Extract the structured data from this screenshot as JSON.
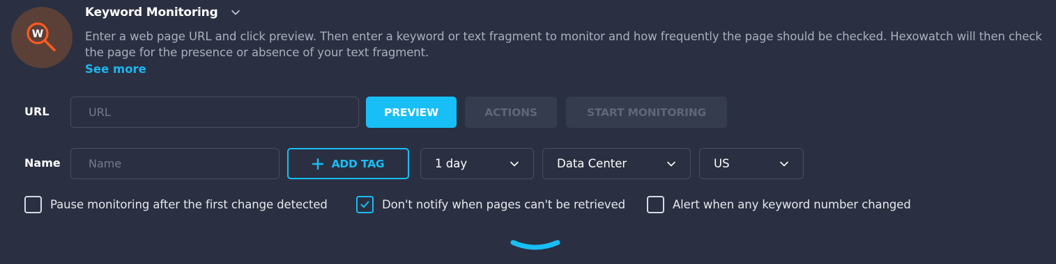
{
  "header": {
    "title": "Keyword Monitoring",
    "description": "Enter a web page URL and click preview. Then enter a keyword or text fragment to monitor and how frequently the page should be checked. Hexowatch will then check the page for the presence or absence of your text fragment.",
    "see_more": "See more",
    "logo_letter": "W",
    "icon": "magnifier-logo-icon"
  },
  "url_row": {
    "label": "URL",
    "input_placeholder": "URL",
    "input_value": "",
    "preview_label": "PREVIEW",
    "actions_label": "ACTIONS",
    "start_label": "START MONITORING"
  },
  "name_row": {
    "label": "Name",
    "input_placeholder": "Name",
    "input_value": "",
    "add_tag_label": "ADD TAG",
    "frequency": "1 day",
    "proxy_type": "Data Center",
    "location": "US"
  },
  "options": [
    {
      "label": "Pause monitoring after the first change detected",
      "checked": false
    },
    {
      "label": "Don't notify when pages can't be retrieved",
      "checked": true
    },
    {
      "label": "Alert when any keyword number changed",
      "checked": false
    }
  ],
  "colors": {
    "background": "#2a3041",
    "accent": "#18bff6",
    "logo_bg": "#5b4038",
    "logo_stroke": "#ff5a1f"
  }
}
